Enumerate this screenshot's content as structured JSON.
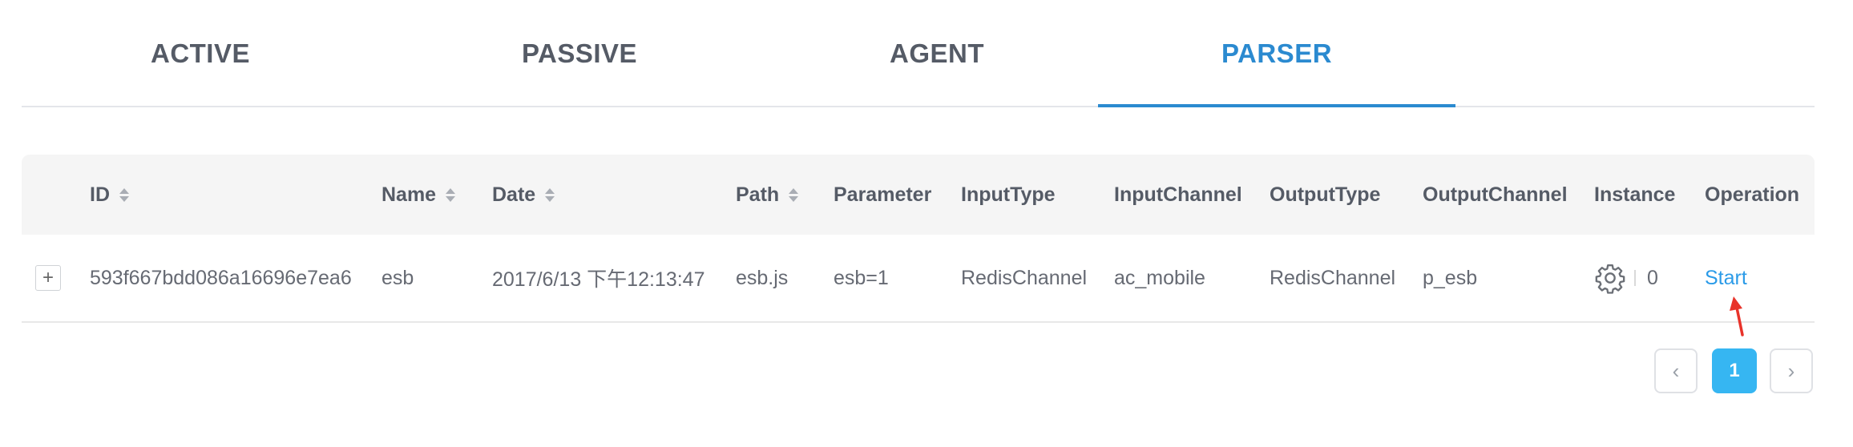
{
  "tabs": [
    {
      "label": "ACTIVE"
    },
    {
      "label": "PASSIVE"
    },
    {
      "label": "AGENT"
    },
    {
      "label": "PARSER",
      "active": true
    }
  ],
  "table": {
    "columns": {
      "id": "ID",
      "name": "Name",
      "date": "Date",
      "path": "Path",
      "parameter": "Parameter",
      "input_type": "InputType",
      "input_channel": "InputChannel",
      "output_type": "OutputType",
      "output_channel": "OutputChannel",
      "instance": "Instance",
      "operation": "Operation"
    },
    "rows": [
      {
        "expand": "+",
        "id": "593f667bdd086a16696e7ea6",
        "name": "esb",
        "date": "2017/6/13 下午12:13:47",
        "path": "esb.js",
        "parameter": "esb=1",
        "input_type": "RedisChannel",
        "input_channel": "ac_mobile",
        "output_type": "RedisChannel",
        "output_channel": "p_esb",
        "instance_count": "0",
        "operation": "Start"
      }
    ]
  },
  "pagination": {
    "prev": "‹",
    "current": "1",
    "next": "›"
  },
  "colors": {
    "accent": "#2b8ad0",
    "link": "#2b9be8",
    "page_active": "#36b6f2",
    "annotation_arrow": "#e8332a"
  }
}
